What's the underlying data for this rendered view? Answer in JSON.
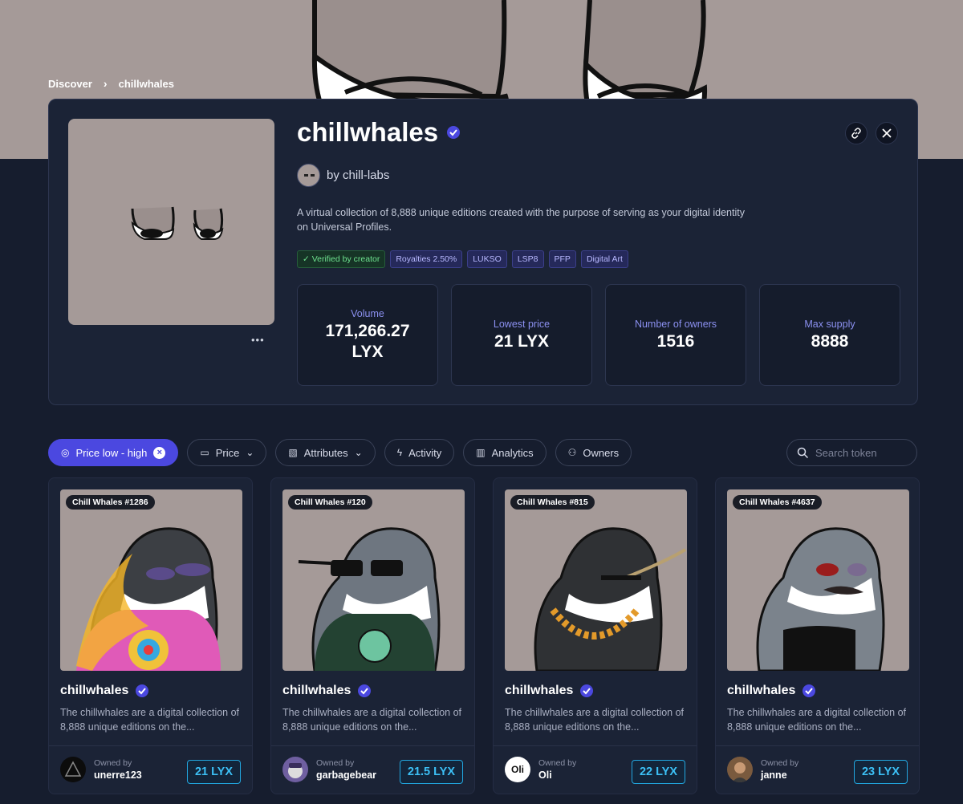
{
  "breadcrumb": {
    "root": "Discover",
    "current": "chillwhales"
  },
  "collection": {
    "title": "chillwhales",
    "creator": "by chill-labs",
    "description": "A virtual collection of 8,888 unique editions created with the purpose of serving as your digital identity on Universal Profiles.",
    "more": "•••",
    "tags": [
      "✓ Verified by creator",
      "Royalties 2.50%",
      "LUKSO",
      "LSP8",
      "PFP",
      "Digital Art"
    ],
    "stats": [
      {
        "label": "Volume",
        "value": "171,266.27 LYX"
      },
      {
        "label": "Lowest price",
        "value": "21 LYX"
      },
      {
        "label": "Number of owners",
        "value": "1516"
      },
      {
        "label": "Max supply",
        "value": "8888"
      }
    ]
  },
  "filters": {
    "sort": "Price low - high",
    "price": "Price",
    "attributes": "Attributes",
    "activity": "Activity",
    "analytics": "Analytics",
    "owners": "Owners",
    "search_placeholder": "Search token"
  },
  "cards": [
    {
      "token": "Chill Whales #1286",
      "title": "chillwhales",
      "desc": "The chillwhales are a digital collection of 8,888 unique editions on the...",
      "owned_label": "Owned by",
      "owner": "unerre123",
      "price": "21 LYX"
    },
    {
      "token": "Chill Whales #120",
      "title": "chillwhales",
      "desc": "The chillwhales are a digital collection of 8,888 unique editions on the...",
      "owned_label": "Owned by",
      "owner": "garbagebear",
      "price": "21.5 LYX"
    },
    {
      "token": "Chill Whales #815",
      "title": "chillwhales",
      "desc": "The chillwhales are a digital collection of 8,888 unique editions on the...",
      "owned_label": "Owned by",
      "owner": "Oli",
      "owner_avatar_text": "Oli",
      "price": "22 LYX"
    },
    {
      "token": "Chill Whales #4637",
      "title": "chillwhales",
      "desc": "The chillwhales are a digital collection of 8,888 unique editions on the...",
      "owned_label": "Owned by",
      "owner": "janne",
      "price": "23 LYX"
    }
  ],
  "colors": {
    "accent": "#4b48e0",
    "price_border": "#22a7e0",
    "verified_green": "#6ee28f",
    "banner_bg": "#a59a98"
  },
  "icons": [
    "chevron-right-icon",
    "verified-badge-icon",
    "link-icon",
    "x-logo-icon",
    "more-icon",
    "sort-icon",
    "close-icon",
    "wallet-icon",
    "chevron-down-icon",
    "attributes-icon",
    "bolt-icon",
    "bar-chart-icon",
    "users-icon",
    "search-icon"
  ]
}
